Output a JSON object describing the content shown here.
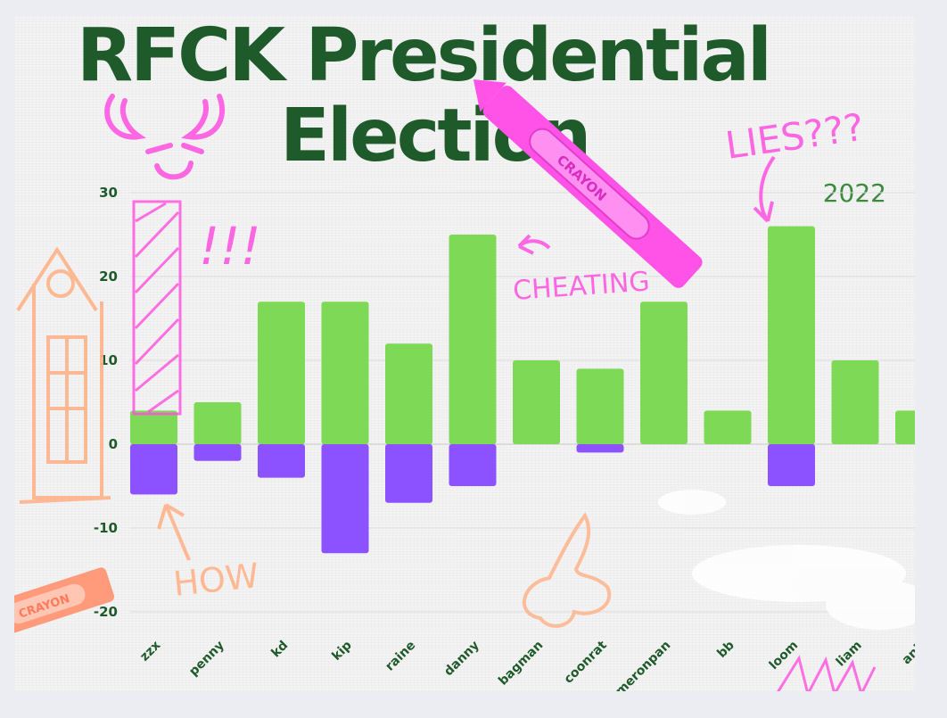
{
  "page": {
    "title_line1": "RFCK Presidential",
    "title_line2": "Election",
    "year": "2022"
  },
  "colors": {
    "positive": "#7ed957",
    "negative": "#8c52ff",
    "title": "#1f5a2a",
    "doodle_pink": "#ff4fe0",
    "doodle_orange": "#ffb38a"
  },
  "annotations": {
    "lies": "LIES???",
    "cheating": "CHEATING",
    "exclaim": "!!!",
    "how": "HOW",
    "crayon_top": "CRAYON",
    "crayon_left": "CRAYON"
  },
  "chart_data": {
    "type": "bar",
    "stacked": true,
    "categories": [
      "zzx",
      "penny",
      "kd",
      "kip",
      "raine",
      "danny",
      "bagman",
      "coonrat",
      "meronpan",
      "bb",
      "loom",
      "liam",
      "anif"
    ],
    "series": [
      {
        "values": [
          4,
          5,
          17,
          17,
          12,
          25,
          10,
          9,
          17,
          4,
          26,
          10,
          4
        ]
      },
      {
        "values": [
          -6,
          -2,
          -4,
          -13,
          -7,
          -5,
          0,
          -1,
          0,
          0,
          -5,
          0,
          0
        ]
      }
    ],
    "yticks": [
      30,
      20,
      10,
      0,
      -10,
      -20
    ],
    "ylim": [
      -20,
      30
    ],
    "grid": true
  }
}
